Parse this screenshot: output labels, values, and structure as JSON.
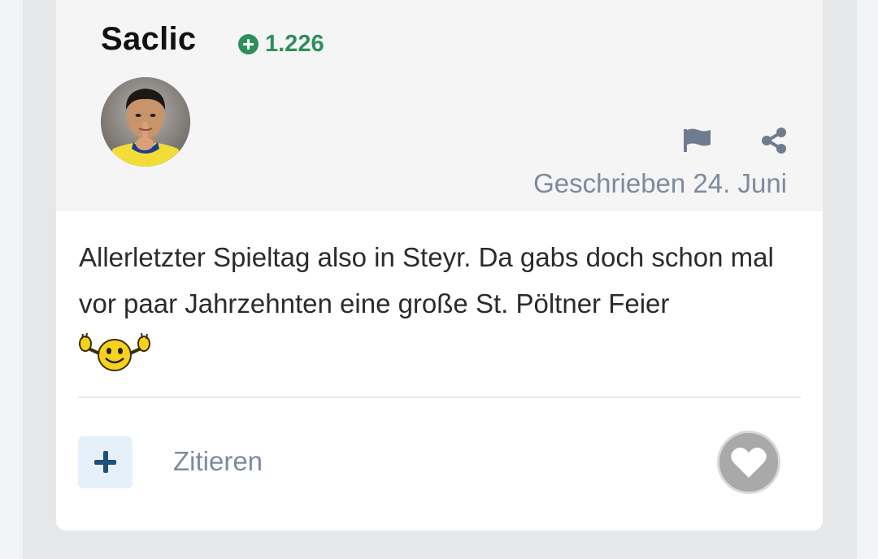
{
  "post": {
    "author": "Saclic",
    "reputation": "1.226",
    "date_label": "Geschrieben 24. Juni",
    "body_text": "Allerletzter Spieltag also in Steyr. Da gabs doch schon mal vor paar Jahrzehnten eine große St. Pöltner Feier"
  },
  "actions": {
    "quote_label": "Zitieren"
  },
  "icons": {
    "reputation": "plus-circle-icon",
    "report": "flag-icon",
    "share": "share-icon",
    "add": "plus-icon",
    "like": "heart-icon",
    "emoji": "cheering-smiley-icon"
  },
  "colors": {
    "reputation": "#2e8f5a",
    "meta_text": "#7e8aa0",
    "add_button_bg": "#e6f0fa",
    "add_button_fg": "#1f4f7a",
    "like_button_bg": "#a9a9a9"
  }
}
